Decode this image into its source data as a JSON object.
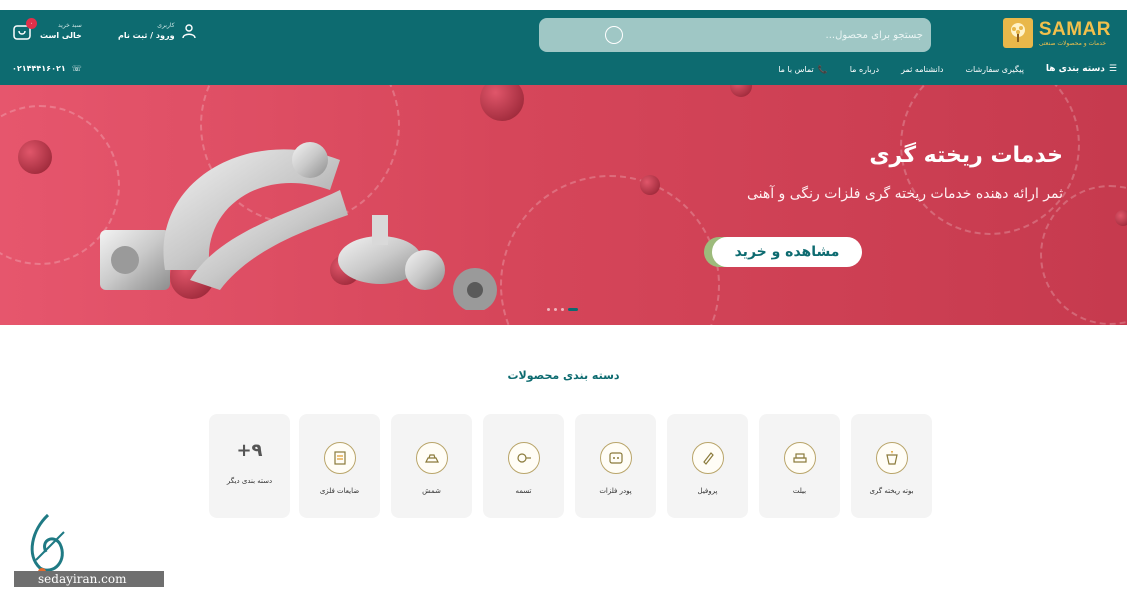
{
  "brand": {
    "name": "SAMAR",
    "tagline": "خدمات و محصولات صنعتی",
    "accent": "#f2c04c",
    "primary": "#0d6b70"
  },
  "search": {
    "placeholder": "جستجو برای محصول..."
  },
  "account": {
    "caption": "کاربری",
    "label": "ورود / ثبت نام"
  },
  "cart": {
    "caption": "سبد خرید",
    "status": "خالی است",
    "badge": "۰"
  },
  "nav": {
    "categories": "دسته بندی ها",
    "items": [
      "پیگیری سفارشات",
      "دانشنامه ثمر",
      "درباره ما",
      "تماس با ما"
    ]
  },
  "phone": "۰۲۱۴۴۴۱۶۰۲۱",
  "banner": {
    "title": "خدمات ریخته گری",
    "subtitle": "ثمر ارائه دهنده خدمات ریخته گری فلزات رنگی و آهنی",
    "button": "مشاهده و خرید",
    "background": "#d6465a"
  },
  "categories": {
    "title": "دسته بندی محصولات",
    "items": [
      {
        "label": "بوته ریخته گری",
        "icon": "crucible-icon"
      },
      {
        "label": "بیلت",
        "icon": "billet-icon"
      },
      {
        "label": "پروفیل",
        "icon": "profile-icon"
      },
      {
        "label": "پودر فلزات",
        "icon": "powder-icon"
      },
      {
        "label": "تسمه",
        "icon": "strip-icon"
      },
      {
        "label": "شمش",
        "icon": "ingot-icon"
      },
      {
        "label": "ضایعات فلزی",
        "icon": "scrap-icon"
      },
      {
        "label": "دسته بندی دیگر",
        "count": "+۹"
      }
    ]
  },
  "watermark": {
    "text": "sedayiran.com"
  }
}
